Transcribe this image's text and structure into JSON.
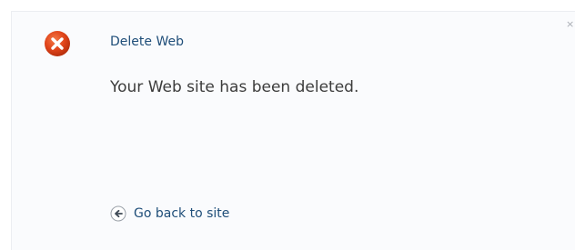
{
  "dialog": {
    "close_glyph": "×",
    "icon": "error-x-circle-icon",
    "title": "Delete Web",
    "message": "Your Web site has been deleted.",
    "back_link": {
      "label": "Go back to site",
      "icon": "back-arrow-circle-icon"
    }
  },
  "colors": {
    "error_red": "#e0441a",
    "link_blue": "#1f4e79",
    "message_gray": "#3c3c3c"
  }
}
